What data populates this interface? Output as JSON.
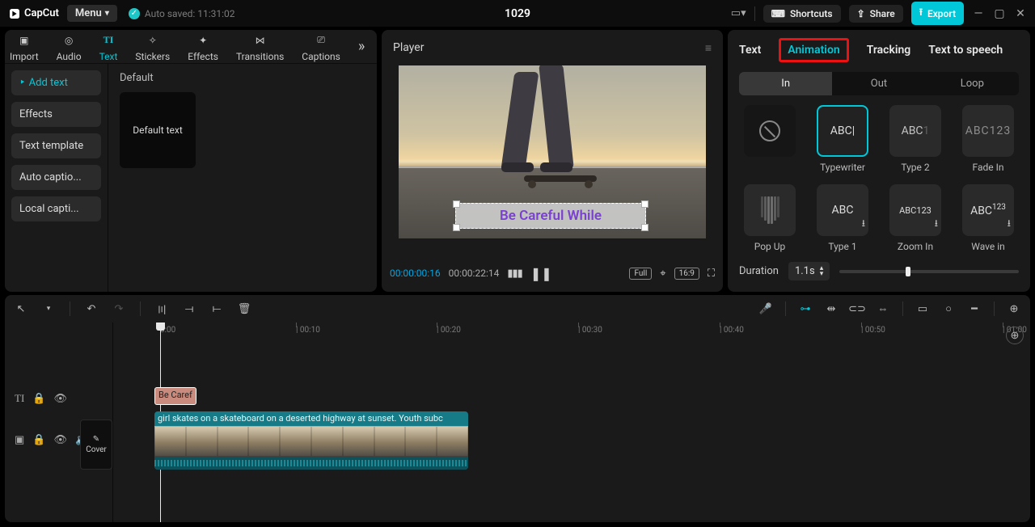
{
  "brand": "CapCut",
  "menu_label": "Menu",
  "autosaved": "Auto saved: 11:31:02",
  "project_title": "1029",
  "topbar": {
    "shortcuts": "Shortcuts",
    "share": "Share",
    "export": "Export"
  },
  "media_tabs": [
    "Import",
    "Audio",
    "Text",
    "Stickers",
    "Effects",
    "Transitions",
    "Captions"
  ],
  "sidebar": {
    "items": [
      "Add text",
      "Effects",
      "Text template",
      "Auto captio...",
      "Local capti..."
    ]
  },
  "left_content": {
    "header": "Default",
    "thumb": "Default text"
  },
  "player": {
    "title": "Player",
    "overlay_text": "Be Careful While",
    "time_current": "00:00:00:16",
    "time_total": "00:00:22:14",
    "full": "Full",
    "aspect": "16:9"
  },
  "inspector": {
    "tabs": [
      "Text",
      "Animation",
      "Tracking",
      "Text to speech"
    ],
    "active_tab": 1,
    "sub": [
      "In",
      "Out",
      "Loop"
    ],
    "active_sub": 0,
    "anims": [
      {
        "label": "",
        "kind": "none"
      },
      {
        "label": "Typewriter",
        "text": "ABC|",
        "selected": true
      },
      {
        "label": "Type 2",
        "text": "ABC1",
        "faded": true
      },
      {
        "label": "Fade In",
        "text": "ABC123",
        "faded": true
      },
      {
        "label": "Pop Up",
        "kind": "popup"
      },
      {
        "label": "Type 1",
        "text": "ABC",
        "dl": true
      },
      {
        "label": "Zoom In",
        "text": "ABC123",
        "small": true,
        "dl": true
      },
      {
        "label": "Wave in",
        "text": "ABC123",
        "wave": true,
        "dl": true
      }
    ],
    "duration_label": "Duration",
    "duration_value": "1.1s"
  },
  "timeline": {
    "cover": "Cover",
    "text_clip": "Be Caref",
    "video_clip": "girl skates on a skateboard on a deserted highway at sunset. Youth subc",
    "ruler": [
      "0:00",
      "| 00:10",
      "| 00:20",
      "| 00:30",
      "| 00:40",
      "| 00:50",
      "| 01:00"
    ]
  }
}
